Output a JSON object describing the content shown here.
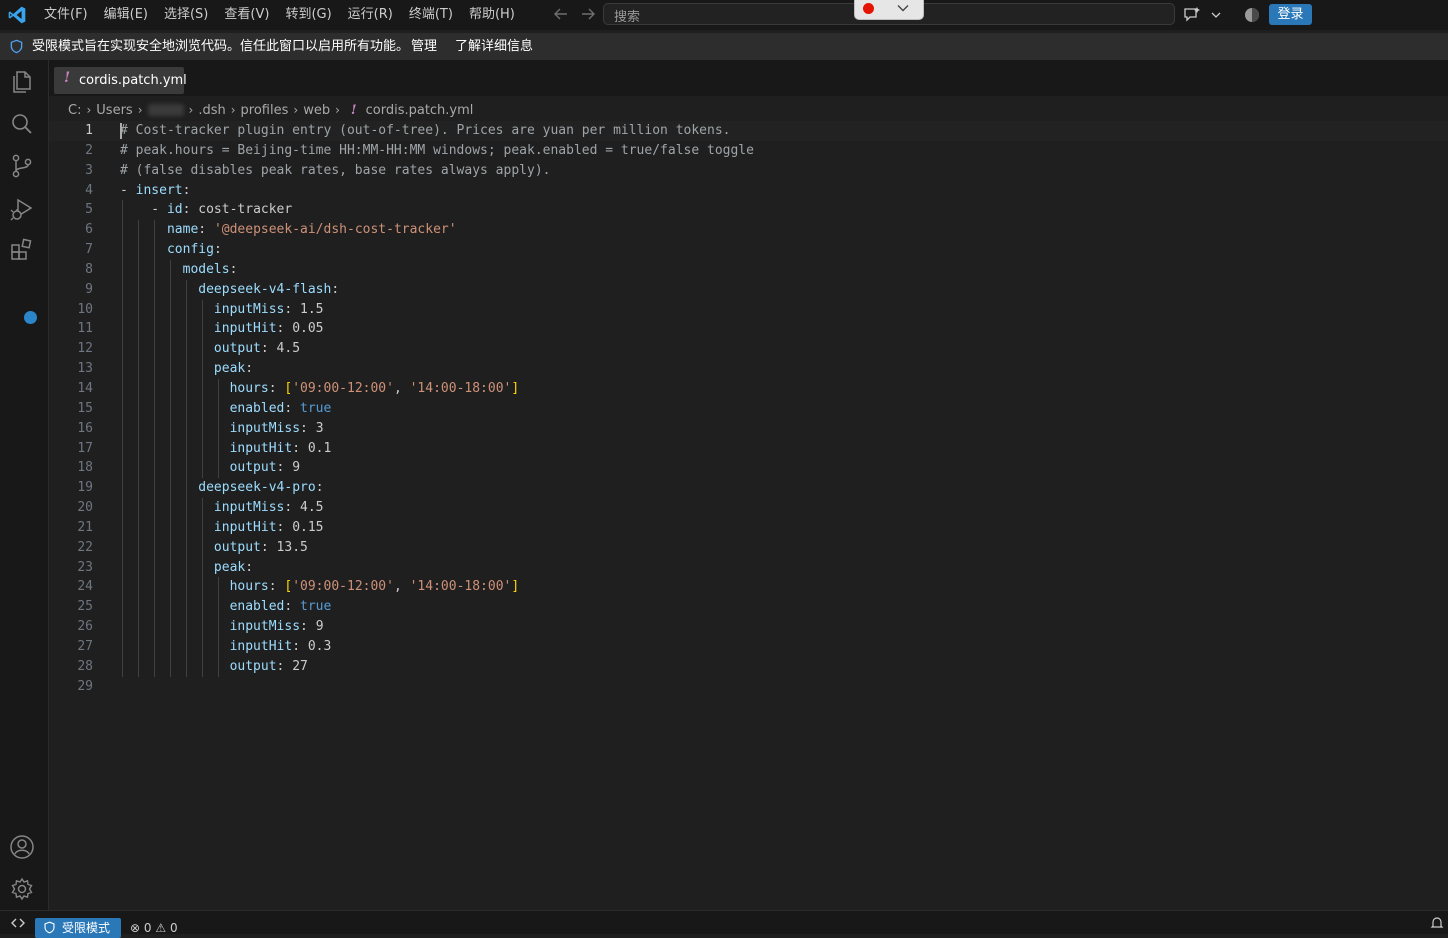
{
  "menu": {
    "items": [
      "文件(F)",
      "编辑(E)",
      "选择(S)",
      "查看(V)",
      "转到(G)",
      "运行(R)",
      "终端(T)",
      "帮助(H)"
    ]
  },
  "search": {
    "placeholder": "搜索"
  },
  "titlebar": {
    "login_label": "登录"
  },
  "restricted_banner": {
    "message": "受限模式旨在实现安全地浏览代码。信任此窗口以启用所有功能。",
    "manage": "管理",
    "learn_more": "了解详细信息"
  },
  "tab": {
    "icon": "!",
    "label": "cordis.patch.yml"
  },
  "breadcrumb": {
    "items": [
      "C:",
      "Users",
      ".dsh",
      "profiles",
      "web"
    ],
    "file_icon": "!",
    "file": "cordis.patch.yml"
  },
  "editor": {
    "current_line": 1,
    "lines": [
      {
        "n": "1",
        "indent": 0,
        "tokens": [
          [
            "c",
            "# Cost-tracker plugin entry (out-of-tree). Prices are yuan per million tokens."
          ]
        ]
      },
      {
        "n": "2",
        "indent": 0,
        "tokens": [
          [
            "c",
            "# peak.hours = Beijing-time HH:MM-HH:MM windows; peak.enabled = true/false toggle"
          ]
        ]
      },
      {
        "n": "3",
        "indent": 0,
        "tokens": [
          [
            "c",
            "# (false disables peak rates, base rates always apply)."
          ]
        ]
      },
      {
        "n": "4",
        "indent": 0,
        "tokens": [
          [
            "p",
            "- "
          ],
          [
            "k",
            "insert"
          ],
          [
            "p",
            ":"
          ]
        ]
      },
      {
        "n": "5",
        "indent": 1,
        "tokens": [
          [
            "p",
            "    - "
          ],
          [
            "k",
            "id"
          ],
          [
            "p",
            ": "
          ],
          [
            "t",
            "cost-tracker"
          ]
        ]
      },
      {
        "n": "6",
        "indent": 3,
        "tokens": [
          [
            "p",
            "      "
          ],
          [
            "k",
            "name"
          ],
          [
            "p",
            ": "
          ],
          [
            "s",
            "'@deepseek-ai/dsh-cost-tracker'"
          ]
        ]
      },
      {
        "n": "7",
        "indent": 3,
        "tokens": [
          [
            "p",
            "      "
          ],
          [
            "k",
            "config"
          ],
          [
            "p",
            ":"
          ]
        ]
      },
      {
        "n": "8",
        "indent": 4,
        "tokens": [
          [
            "p",
            "        "
          ],
          [
            "k",
            "models"
          ],
          [
            "p",
            ":"
          ]
        ]
      },
      {
        "n": "9",
        "indent": 5,
        "tokens": [
          [
            "p",
            "          "
          ],
          [
            "k",
            "deepseek-v4-flash"
          ],
          [
            "p",
            ":"
          ]
        ]
      },
      {
        "n": "10",
        "indent": 6,
        "tokens": [
          [
            "p",
            "            "
          ],
          [
            "k",
            "inputMiss"
          ],
          [
            "p",
            ": "
          ],
          [
            "t",
            "1.5"
          ]
        ]
      },
      {
        "n": "11",
        "indent": 6,
        "tokens": [
          [
            "p",
            "            "
          ],
          [
            "k",
            "inputHit"
          ],
          [
            "p",
            ": "
          ],
          [
            "t",
            "0.05"
          ]
        ]
      },
      {
        "n": "12",
        "indent": 6,
        "tokens": [
          [
            "p",
            "            "
          ],
          [
            "k",
            "output"
          ],
          [
            "p",
            ": "
          ],
          [
            "t",
            "4.5"
          ]
        ]
      },
      {
        "n": "13",
        "indent": 6,
        "tokens": [
          [
            "p",
            "            "
          ],
          [
            "k",
            "peak"
          ],
          [
            "p",
            ":"
          ]
        ]
      },
      {
        "n": "14",
        "indent": 7,
        "tokens": [
          [
            "p",
            "              "
          ],
          [
            "k",
            "hours"
          ],
          [
            "p",
            ": "
          ],
          [
            "b",
            "["
          ],
          [
            "s",
            "'09:00-12:00'"
          ],
          [
            "p",
            ", "
          ],
          [
            "s",
            "'14:00-18:00'"
          ],
          [
            "b",
            "]"
          ]
        ]
      },
      {
        "n": "15",
        "indent": 7,
        "tokens": [
          [
            "p",
            "              "
          ],
          [
            "k",
            "enabled"
          ],
          [
            "p",
            ": "
          ],
          [
            "o",
            "true"
          ]
        ]
      },
      {
        "n": "16",
        "indent": 7,
        "tokens": [
          [
            "p",
            "              "
          ],
          [
            "k",
            "inputMiss"
          ],
          [
            "p",
            ": "
          ],
          [
            "t",
            "3"
          ]
        ]
      },
      {
        "n": "17",
        "indent": 7,
        "tokens": [
          [
            "p",
            "              "
          ],
          [
            "k",
            "inputHit"
          ],
          [
            "p",
            ": "
          ],
          [
            "t",
            "0.1"
          ]
        ]
      },
      {
        "n": "18",
        "indent": 7,
        "tokens": [
          [
            "p",
            "              "
          ],
          [
            "k",
            "output"
          ],
          [
            "p",
            ": "
          ],
          [
            "t",
            "9"
          ]
        ]
      },
      {
        "n": "19",
        "indent": 5,
        "tokens": [
          [
            "p",
            "          "
          ],
          [
            "k",
            "deepseek-v4-pro"
          ],
          [
            "p",
            ":"
          ]
        ]
      },
      {
        "n": "20",
        "indent": 6,
        "tokens": [
          [
            "p",
            "            "
          ],
          [
            "k",
            "inputMiss"
          ],
          [
            "p",
            ": "
          ],
          [
            "t",
            "4.5"
          ]
        ]
      },
      {
        "n": "21",
        "indent": 6,
        "tokens": [
          [
            "p",
            "            "
          ],
          [
            "k",
            "inputHit"
          ],
          [
            "p",
            ": "
          ],
          [
            "t",
            "0.15"
          ]
        ]
      },
      {
        "n": "22",
        "indent": 6,
        "tokens": [
          [
            "p",
            "            "
          ],
          [
            "k",
            "output"
          ],
          [
            "p",
            ": "
          ],
          [
            "t",
            "13.5"
          ]
        ]
      },
      {
        "n": "23",
        "indent": 6,
        "tokens": [
          [
            "p",
            "            "
          ],
          [
            "k",
            "peak"
          ],
          [
            "p",
            ":"
          ]
        ]
      },
      {
        "n": "24",
        "indent": 7,
        "tokens": [
          [
            "p",
            "              "
          ],
          [
            "k",
            "hours"
          ],
          [
            "p",
            ": "
          ],
          [
            "b",
            "["
          ],
          [
            "s",
            "'09:00-12:00'"
          ],
          [
            "p",
            ", "
          ],
          [
            "s",
            "'14:00-18:00'"
          ],
          [
            "b",
            "]"
          ]
        ]
      },
      {
        "n": "25",
        "indent": 7,
        "tokens": [
          [
            "p",
            "              "
          ],
          [
            "k",
            "enabled"
          ],
          [
            "p",
            ": "
          ],
          [
            "o",
            "true"
          ]
        ]
      },
      {
        "n": "26",
        "indent": 7,
        "tokens": [
          [
            "p",
            "              "
          ],
          [
            "k",
            "inputMiss"
          ],
          [
            "p",
            ": "
          ],
          [
            "t",
            "9"
          ]
        ]
      },
      {
        "n": "27",
        "indent": 7,
        "tokens": [
          [
            "p",
            "              "
          ],
          [
            "k",
            "inputHit"
          ],
          [
            "p",
            ": "
          ],
          [
            "t",
            "0.3"
          ]
        ]
      },
      {
        "n": "28",
        "indent": 7,
        "tokens": [
          [
            "p",
            "              "
          ],
          [
            "k",
            "output"
          ],
          [
            "p",
            ": "
          ],
          [
            "t",
            "27"
          ]
        ]
      },
      {
        "n": "29",
        "indent": 0,
        "tokens": []
      }
    ]
  },
  "statusbar": {
    "restricted_label": "受限模式",
    "errors": "0",
    "warnings": "0"
  },
  "colors": {
    "accent": "#2b78b8",
    "yaml_key": "#9cdcfe",
    "yaml_string": "#ce9178",
    "yaml_bool": "#569cd6",
    "comment": "#9ea4a8",
    "bracket": "#ffd700",
    "yaml_file_icon": "#c586c0"
  },
  "icons": [
    "vscode-logo-icon",
    "arrow-left-icon",
    "arrow-right-icon",
    "error-dot-icon",
    "chevron-down-icon",
    "copilot-chat-icon",
    "accounts-toggle-icon",
    "shield-icon",
    "explorer-icon",
    "search-icon",
    "source-control-icon",
    "run-debug-icon",
    "extensions-icon",
    "account-icon",
    "settings-gear-icon",
    "remote-icon",
    "error-icon",
    "warning-icon",
    "bell-icon"
  ]
}
